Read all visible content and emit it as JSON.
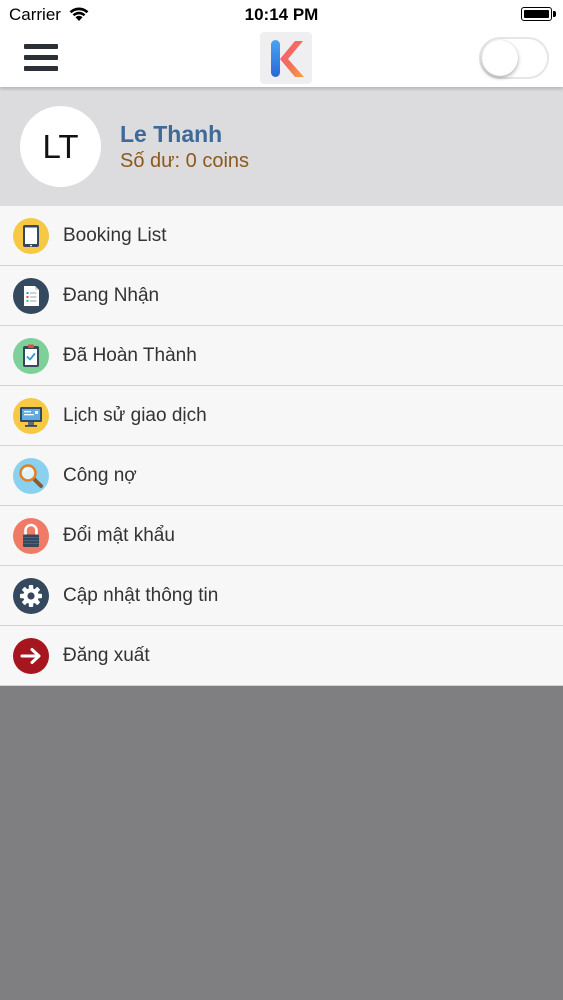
{
  "status_bar": {
    "carrier": "Carrier",
    "time": "10:14 PM"
  },
  "nav": {
    "menu_icon": "hamburger-icon",
    "logo_icon": "k-logo-icon",
    "toggle_on": false
  },
  "profile": {
    "initials": "LT",
    "name": "Le Thanh",
    "balance": "Số dư: 0 coins"
  },
  "menu": {
    "items": [
      {
        "label": "Booking List",
        "icon": "tablet-icon",
        "color": "#f7c844"
      },
      {
        "label": "Đang Nhận",
        "icon": "document-icon",
        "color": "#34495e"
      },
      {
        "label": "Đã Hoàn Thành",
        "icon": "clipboard-check-icon",
        "color": "#7dd098"
      },
      {
        "label": "Lịch sử giao dịch",
        "icon": "monitor-icon",
        "color": "#f7c844"
      },
      {
        "label": "Công nợ",
        "icon": "magnifier-icon",
        "color": "#8ad1f0"
      },
      {
        "label": "Đổi mật khẩu",
        "icon": "lock-icon",
        "color": "#ef7b67"
      },
      {
        "label": "Cập nhật thông tin",
        "icon": "gear-icon",
        "color": "#34495e"
      },
      {
        "label": "Đăng xuất",
        "icon": "arrow-right-icon",
        "color": "#a5161e"
      }
    ]
  },
  "colors": {
    "name": "#3e6a97",
    "balance": "#8b5a1c",
    "profile_bg": "#dcdbdd",
    "overlay_bg": "#7f7e80"
  }
}
